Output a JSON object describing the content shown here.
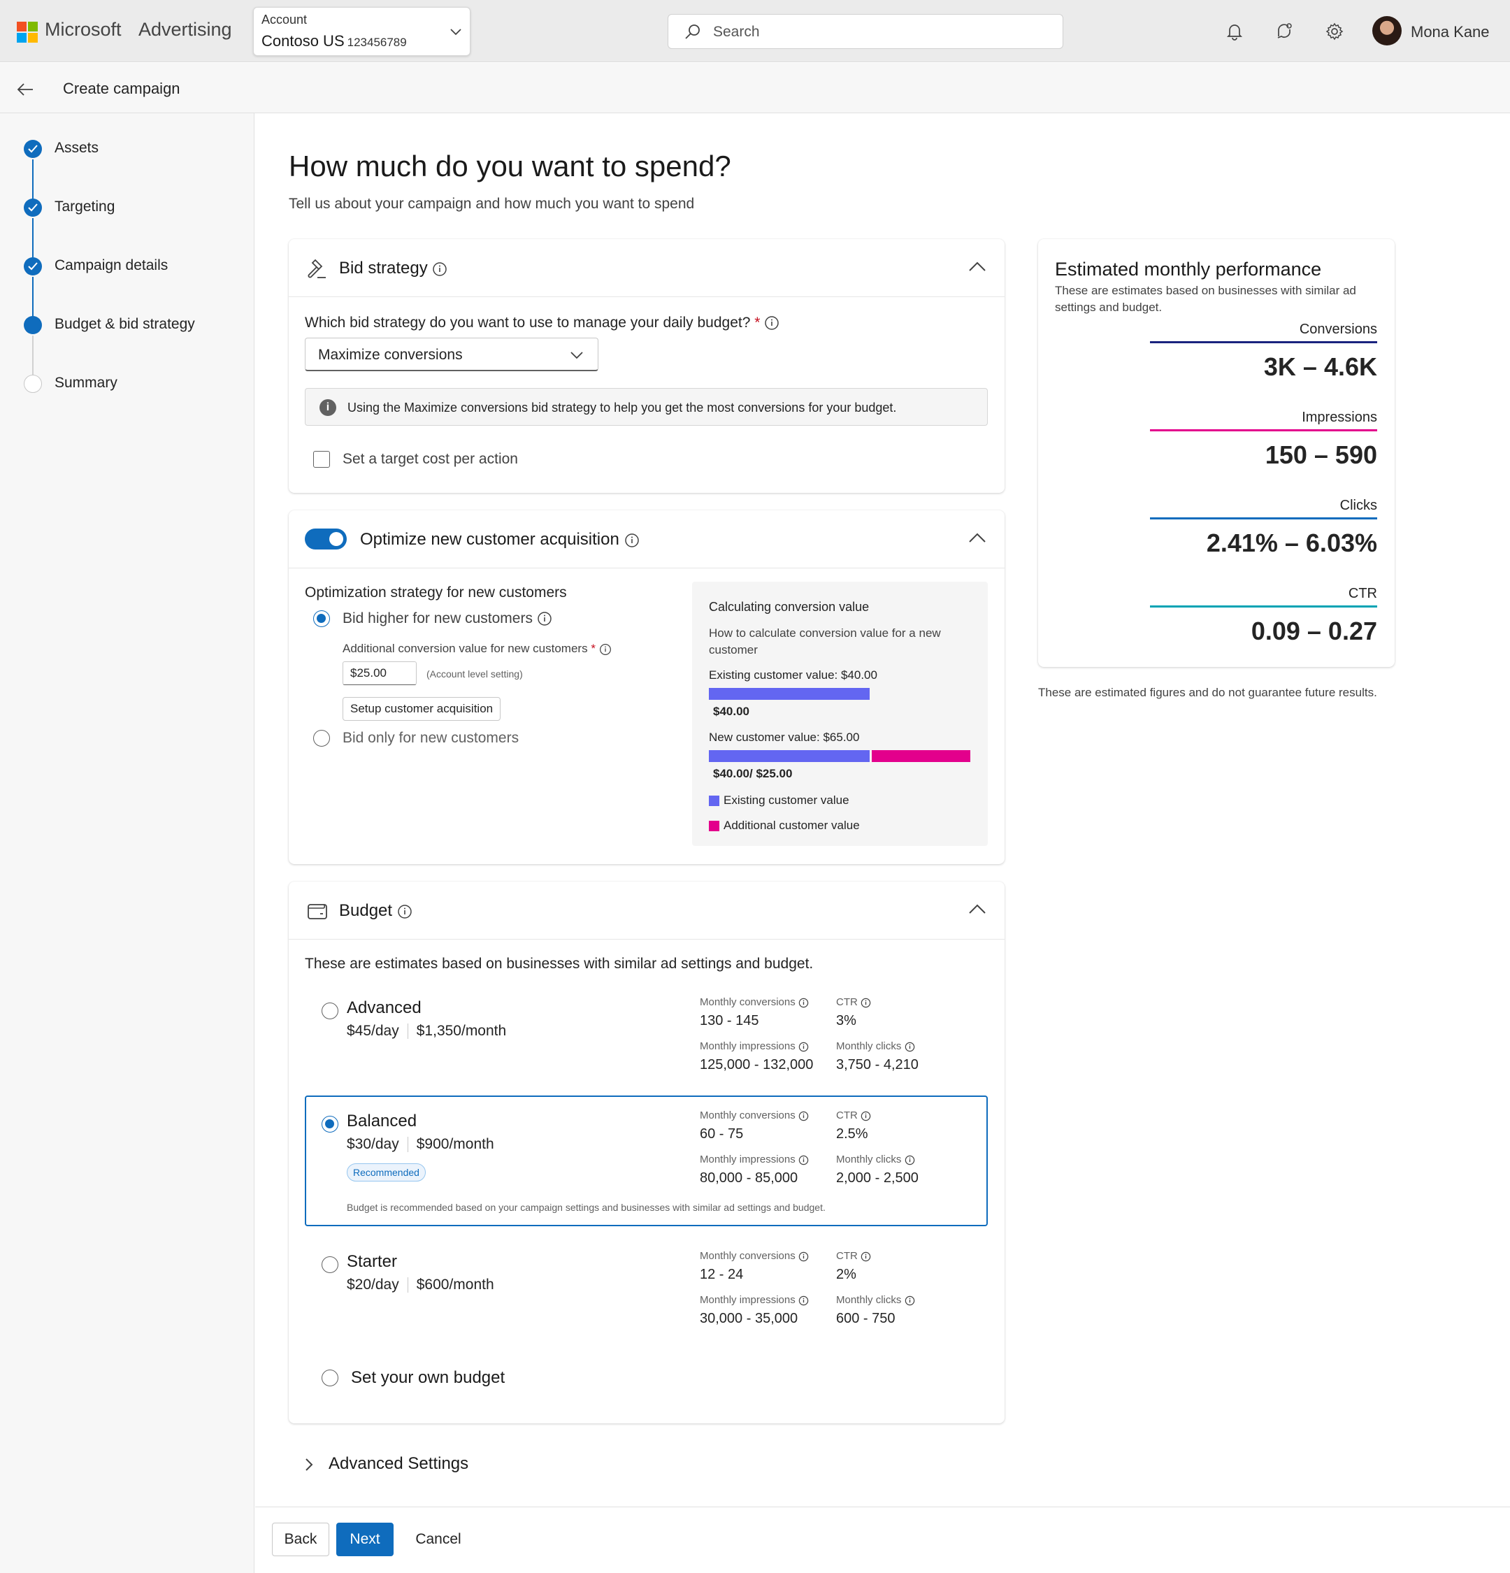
{
  "header": {
    "brand_ms": "Microsoft",
    "brand_product": "Advertising",
    "account_label": "Account",
    "account_name": "Contoso US",
    "account_number": "123456789",
    "search_placeholder": "Search",
    "user_name": "Mona Kane"
  },
  "subheader": {
    "title": "Create campaign"
  },
  "steps": [
    {
      "label": "Assets",
      "state": "done"
    },
    {
      "label": "Targeting",
      "state": "done"
    },
    {
      "label": "Campaign details",
      "state": "done"
    },
    {
      "label": "Budget & bid strategy",
      "state": "current"
    },
    {
      "label": "Summary",
      "state": "todo"
    }
  ],
  "page": {
    "title": "How much do you want to spend?",
    "subtitle": "Tell us about your campaign and how much you want to spend"
  },
  "bid": {
    "title": "Bid strategy",
    "question": "Which bid strategy do you want to use to manage your daily budget?",
    "required_mark": "*",
    "selected": "Maximize conversions",
    "info": "Using the Maximize conversions bid strategy to help you get the most conversions for your budget.",
    "target_cpa_label": "Set a target cost per action"
  },
  "optimize": {
    "title": "Optimize new customer acquisition",
    "toggle_on": true,
    "strategy_label": "Optimization strategy for new customers",
    "option_higher": "Bid higher for new customers",
    "additional_label": "Additional conversion value for new customers",
    "required_mark": "*",
    "additional_value": "$25.00",
    "account_level_note": "(Account level setting)",
    "setup_button": "Setup customer acquisition",
    "option_only": "Bid only for new customers",
    "calc": {
      "title": "Calculating conversion value",
      "desc": "How to calculate conversion value for a new customer",
      "existing_label": "Existing customer value: $40.00",
      "existing_value_label": "$40.00",
      "new_label": "New customer value: $65.00",
      "new_value_label": "$40.00/ $25.00",
      "existing_value": 40,
      "additional_value": 25,
      "legend_existing": "Existing customer value",
      "legend_additional": "Additional customer value",
      "color_existing": "#6366f1",
      "color_additional": "#e3008c"
    }
  },
  "budget": {
    "title": "Budget",
    "intro": "These are estimates based on businesses with similar ad settings and budget.",
    "labels": {
      "conv": "Monthly conversions",
      "ctr": "CTR",
      "impr": "Monthly impressions",
      "clicks": "Monthly clicks"
    },
    "tiers": [
      {
        "name": "Advanced",
        "day_amount": "$45",
        "day_unit": "/day",
        "month_amount": "$1,350",
        "month_unit": "/month",
        "conv": "130 - 145",
        "ctr": "3%",
        "impr": "125,000 - 132,000",
        "clicks": "3,750 - 4,210"
      },
      {
        "name": "Balanced",
        "day_amount": "$30",
        "day_unit": "/day",
        "month_amount": "$900",
        "month_unit": "/month",
        "conv": "60 - 75",
        "ctr": "2.5%",
        "impr": "80,000 - 85,000",
        "clicks": "2,000 - 2,500",
        "badge": "Recommended",
        "note": "Budget is recommended based on your campaign settings and businesses with similar ad settings and budget."
      },
      {
        "name": "Starter",
        "day_amount": "$20",
        "day_unit": "/day",
        "month_amount": "$600",
        "month_unit": "/month",
        "conv": "12 - 24",
        "ctr": "2%",
        "impr": "30,000 - 35,000",
        "clicks": "600 - 750"
      }
    ],
    "own_budget": "Set your own budget"
  },
  "advanced_settings": "Advanced Settings",
  "performance": {
    "title": "Estimated monthly performance",
    "subtitle": "These are estimates based on businesses with similar ad settings and budget.",
    "metrics": [
      {
        "label": "Conversions",
        "value": "3K – 4.6K",
        "color": "#1a237e"
      },
      {
        "label": "Impressions",
        "value": "150 – 590",
        "color": "#e3008c"
      },
      {
        "label": "Clicks",
        "value": "2.41% – 6.03%",
        "color": "#0f6cbd"
      },
      {
        "label": "CTR",
        "value": "0.09 – 0.27",
        "color": "#00a3b4"
      }
    ],
    "note": "These are estimated figures and do not guarantee future results."
  },
  "footer": {
    "back": "Back",
    "next": "Next",
    "cancel": "Cancel"
  }
}
